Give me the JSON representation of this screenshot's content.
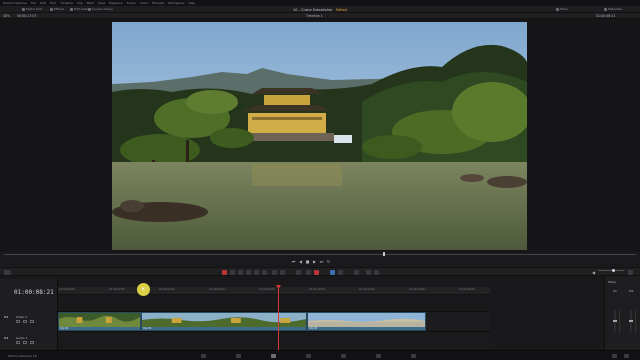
{
  "menu": {
    "items": [
      "DaVinci Resolve",
      "File",
      "Edit",
      "Trim",
      "Timeline",
      "Clip",
      "Mark",
      "View",
      "Playback",
      "Fusion",
      "Color",
      "Fairlight",
      "Workspace",
      "Help"
    ]
  },
  "toolbar": {
    "media_pool": "Media Pool",
    "effects": "Effects",
    "edit_index": "Edit Index",
    "sound_library": "Sound Library",
    "project_title": "10 - Crane Establisher",
    "project_status": "Edited",
    "mixer": "Mixer",
    "metadata": "Metadata"
  },
  "viewer": {
    "zoom": "40%",
    "source_timecode": "00:00:17:07",
    "timeline_name": "Timeline 1",
    "record_timecode": "01:00:06:21",
    "scrub_fraction": 0.61
  },
  "timeline": {
    "timecode": "01:00:08:21",
    "ruler_ticks": [
      "01:00:00:00",
      "01:00:02:00",
      "01:00:04:00",
      "01:00:06:00",
      "01:00:08:00",
      "01:00:10:00",
      "01:00:12:00",
      "01:00:14:00",
      "01:00:16:00"
    ],
    "tracks": [
      {
        "id": "V1",
        "name": "Video 1"
      },
      {
        "id": "A1",
        "name": "Audio 1"
      }
    ],
    "clips": [
      {
        "name": "Clip 01"
      },
      {
        "name": "Clip 02"
      },
      {
        "name": "Clip 03"
      }
    ]
  },
  "mixer_panel": {
    "title": "Mixer",
    "channels": [
      "A1",
      "M1"
    ]
  },
  "status": {
    "app_label": "DaVinci Resolve 18",
    "pages": [
      "media",
      "cut",
      "edit",
      "fusion",
      "color",
      "fairlight",
      "deliver"
    ],
    "active_page": "edit"
  },
  "colors": {
    "accent": "#e6a233",
    "playhead": "#d43a33",
    "clip": "#3e6d8c"
  }
}
